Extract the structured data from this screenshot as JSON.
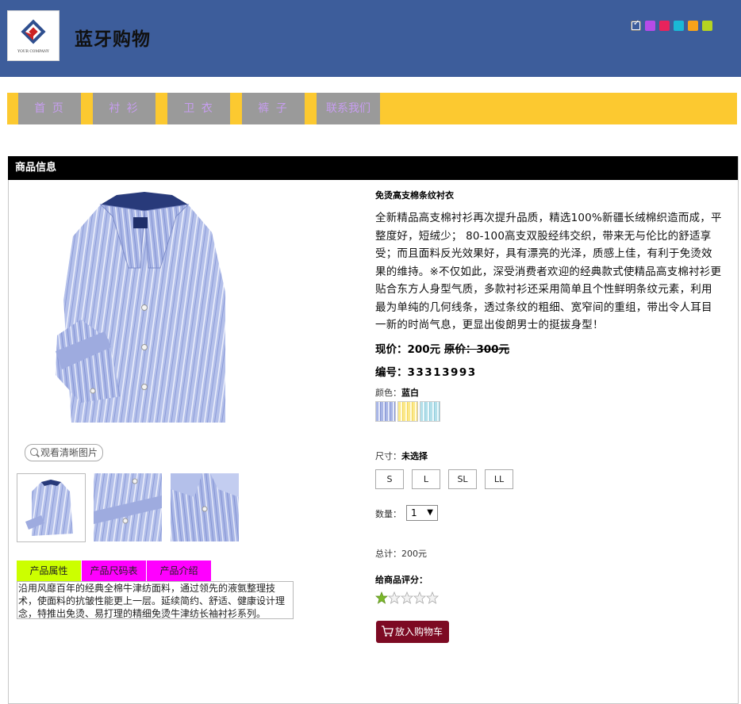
{
  "header": {
    "site_title": "蓝牙购物",
    "logo_text": "YOUR COMPANY",
    "theme_swatches": [
      "#3d5d9b",
      "#b64be8",
      "#e8235c",
      "#1ab8d6",
      "#f7a21b",
      "#b5d421"
    ]
  },
  "nav": {
    "items": [
      {
        "label": "首 页"
      },
      {
        "label": "衬 衫"
      },
      {
        "label": "卫 衣"
      },
      {
        "label": "裤 子"
      },
      {
        "label": "联系我们"
      }
    ]
  },
  "panel": {
    "title": "商品信息"
  },
  "gallery": {
    "zoom_label": "观看清晰图片"
  },
  "tabs": {
    "items": [
      {
        "label": "产品属性",
        "color": "#ccff00"
      },
      {
        "label": "产品尺码表",
        "color": "#ff00ff"
      },
      {
        "label": "产品介绍",
        "color": "#ff00ff"
      }
    ],
    "content": "沿用风靡百年的经典全棉牛津纺面料，通过领先的液氨整理技术，使面料的抗皱性能更上一层。延续简约、舒适、健康设计理念，特推出免烫、易打理的精细免烫牛津纺长袖衬衫系列。"
  },
  "product": {
    "name": "免烫高支棉条纹衬衣",
    "description": "全新精品高支棉衬衫再次提升品质，精选100%新疆长绒棉织造而成，平整度好，短绒少； 80-100高支双股经纬交织，带来无与伦比的舒适享受；而且面料反光效果好，具有漂亮的光泽，质感上佳，有利于免烫效果的维持。※不仅如此，深受消费者欢迎的经典款式使精品高支棉衬衫更贴合东方人身型气质，多款衬衫还采用简单且个性鲜明条纹元素，利用最为单纯的几何线条，透过条纹的粗细、宽窄间的重组，带出令人耳目一新的时尚气息，更显出俊朗男士的挺拔身型！",
    "price_label": "现价：200元",
    "orig_label": "原价：",
    "orig_value": "300元",
    "sku_label": "编号：",
    "sku_value": "33313993",
    "color_label": "颜色：",
    "color_value": "蓝白",
    "color_swatches": [
      "#a9b6e6",
      "#fbe98a",
      "#b3e0ea"
    ],
    "size_label": "尺寸：",
    "size_value": "未选择",
    "sizes": [
      "S",
      "L",
      "SL",
      "LL"
    ],
    "qty_label": "数量：",
    "qty_value": "1",
    "total_label": "总计：200元",
    "rating_label": "给商品评分：",
    "rating": 1,
    "rating_max": 5,
    "cart_label": "放入购物车"
  }
}
